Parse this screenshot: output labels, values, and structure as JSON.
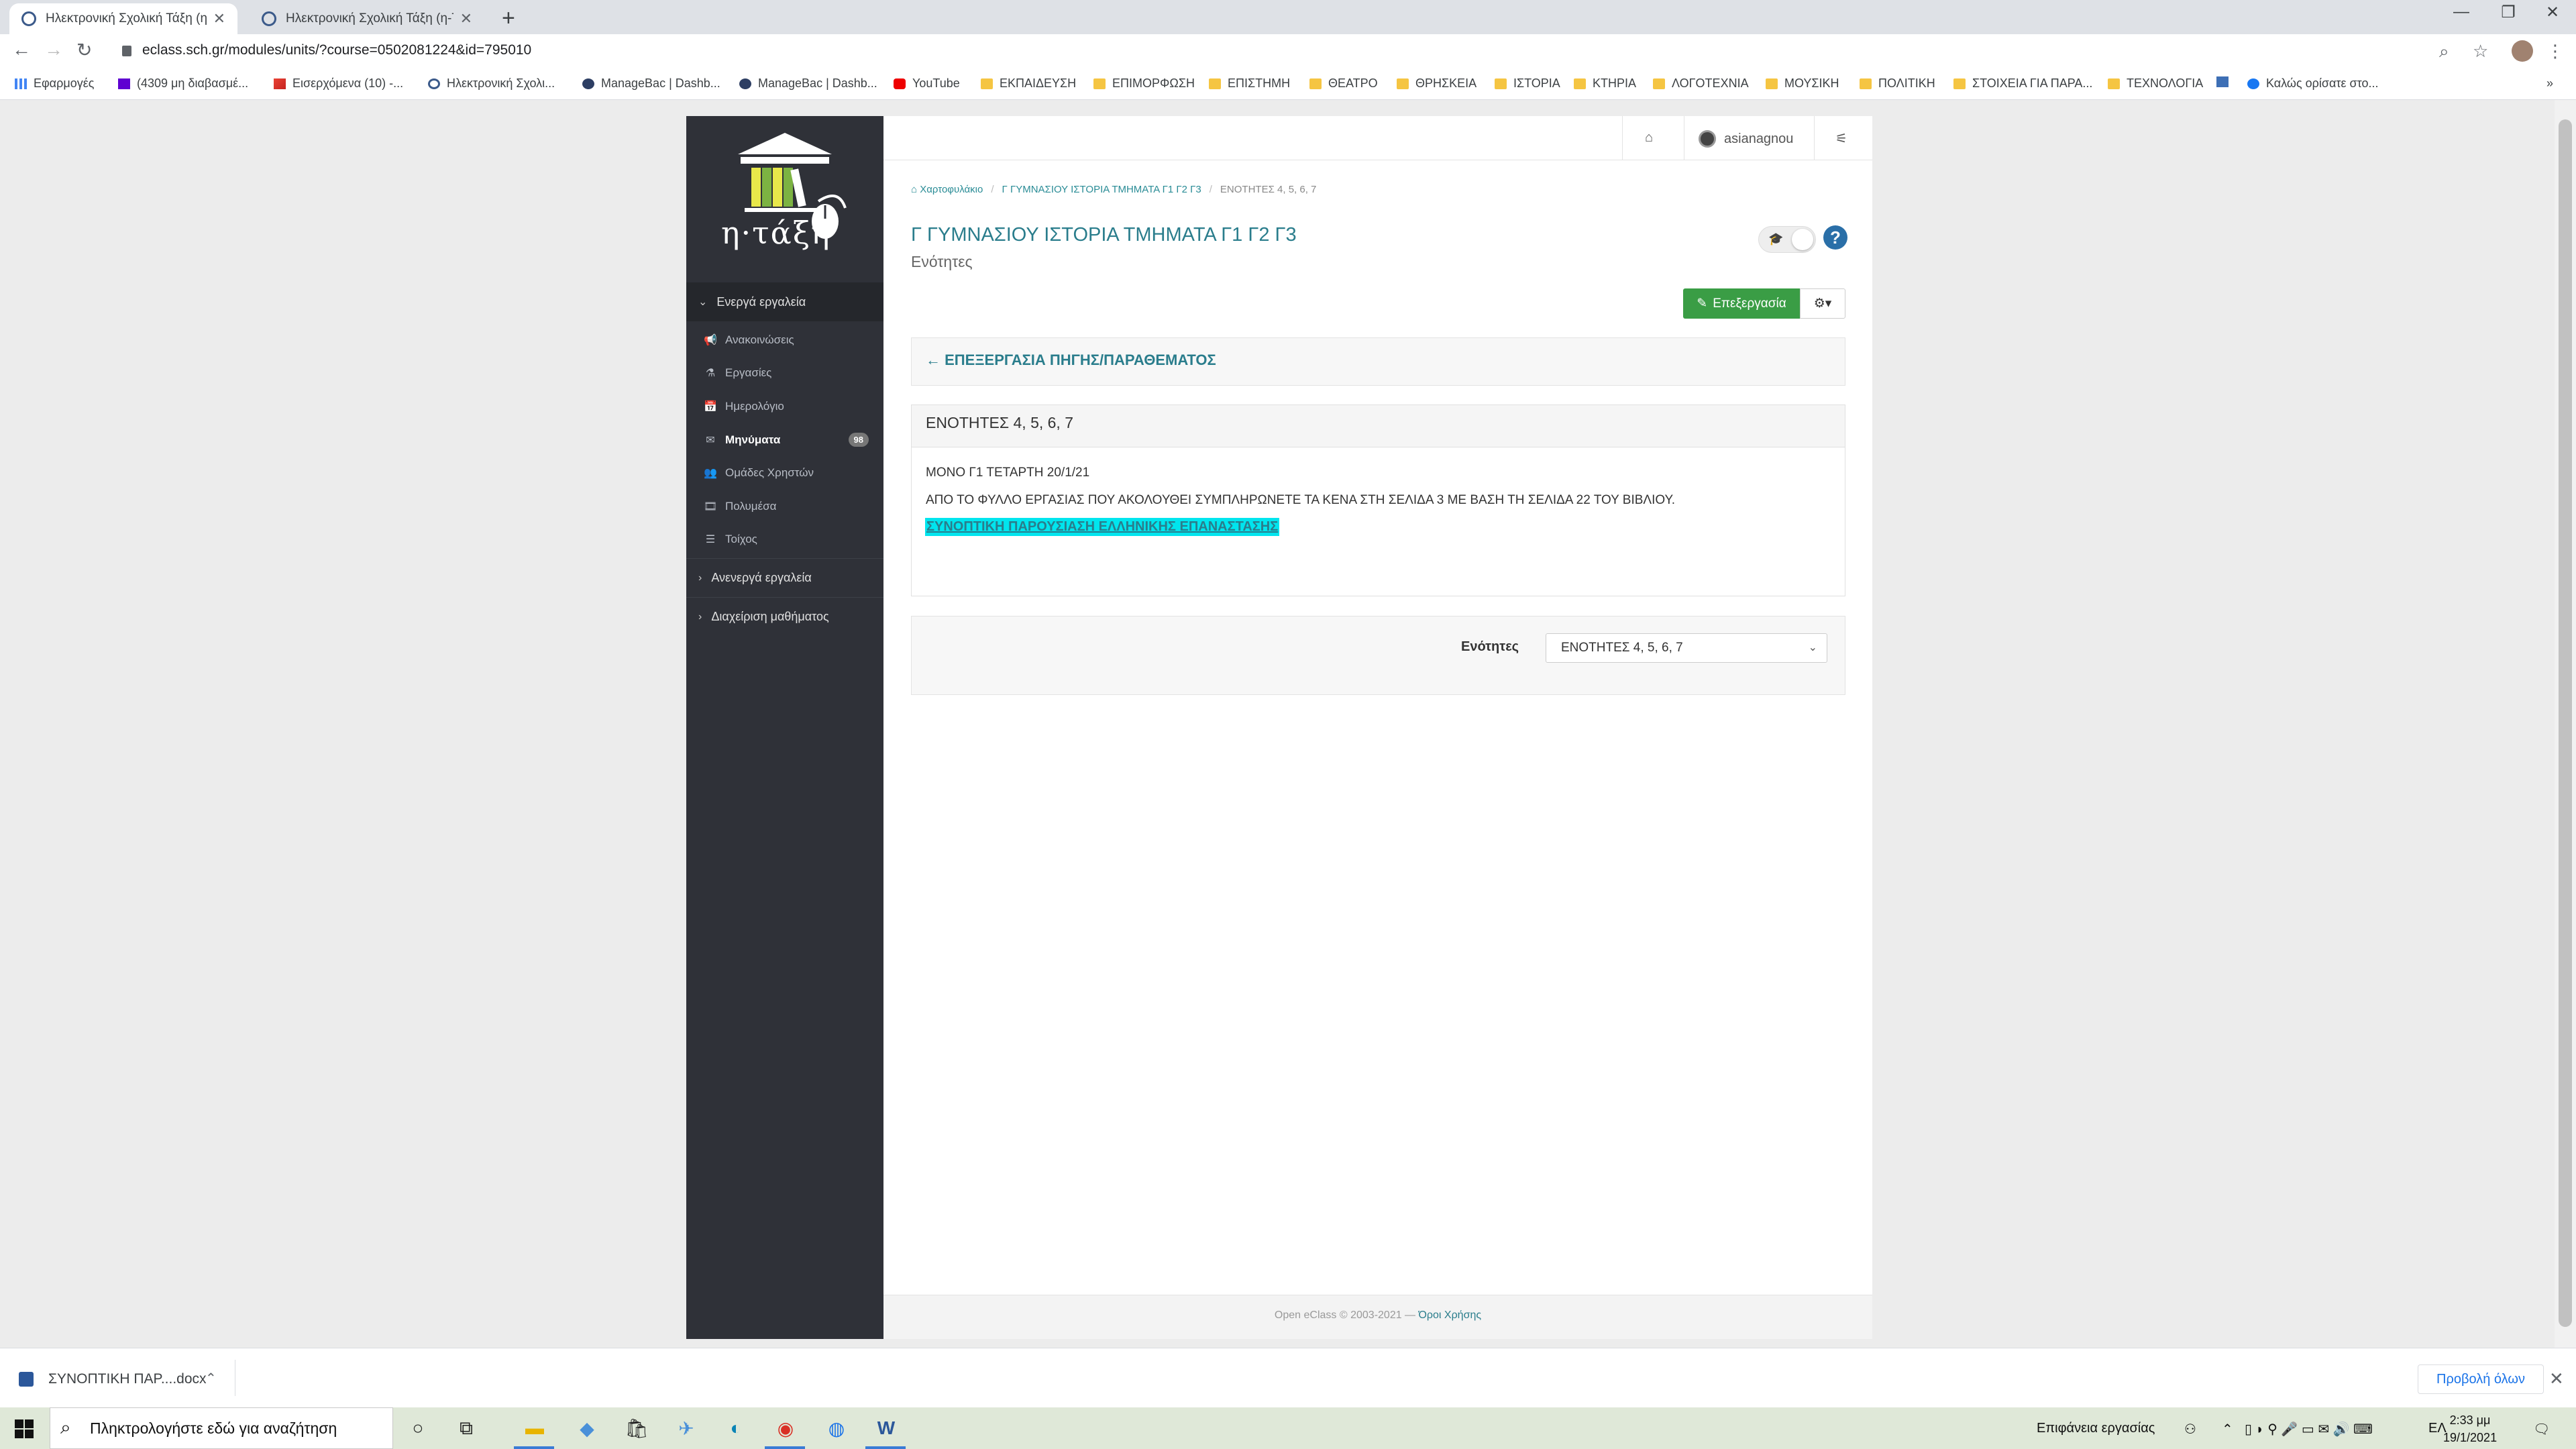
{
  "browser": {
    "tabs": [
      {
        "title": "Ηλεκτρονική Σχολική Τάξη (η-Τάξη)",
        "active": true
      },
      {
        "title": "Ηλεκτρονική Σχολική Τάξη (η-Τάξη)",
        "active": false
      }
    ],
    "url": "eclass.sch.gr/modules/units/?course=0502081224&id=795010",
    "bookmarks": [
      {
        "label": "Εφαρμογές",
        "icon": "apps-icon"
      },
      {
        "label": "(4309 μη διαβασμέ...",
        "icon": "yahoo-icon"
      },
      {
        "label": "Εισερχόμενα (10) -...",
        "icon": "gmail-icon"
      },
      {
        "label": "Ηλεκτρονική Σχολι...",
        "icon": "eclass-icon"
      },
      {
        "label": "ManageBac | Dashb...",
        "icon": "managebac-icon"
      },
      {
        "label": "ManageBac | Dashb...",
        "icon": "managebac-icon"
      },
      {
        "label": "YouTube",
        "icon": "youtube-icon"
      },
      {
        "label": "ΕΚΠΑΙΔΕΥΣΗ",
        "icon": "folder-icon"
      },
      {
        "label": "ΕΠΙΜΟΡΦΩΣΗ",
        "icon": "folder-icon"
      },
      {
        "label": "ΕΠΙΣΤΗΜΗ",
        "icon": "folder-icon"
      },
      {
        "label": "ΘΕΑΤΡΟ",
        "icon": "folder-icon"
      },
      {
        "label": "ΘΡΗΣΚΕΙΑ",
        "icon": "folder-icon"
      },
      {
        "label": "ΙΣΤΟΡΙΑ",
        "icon": "folder-icon"
      },
      {
        "label": "ΚΤΗΡΙΑ",
        "icon": "folder-icon"
      },
      {
        "label": "ΛΟΓΟΤΕΧΝΙΑ",
        "icon": "folder-icon"
      },
      {
        "label": "ΜΟΥΣΙΚΗ",
        "icon": "folder-icon"
      },
      {
        "label": "ΠΟΛΙΤΙΚΗ",
        "icon": "folder-icon"
      },
      {
        "label": "ΣΤΟΙΧΕΙΑ ΓΙΑ ΠΑΡΑ...",
        "icon": "folder-icon"
      },
      {
        "label": "ΤΕΧΝΟΛΟΓΙΑ",
        "icon": "folder-icon"
      },
      {
        "label": "Καλώς ορίσατε στο...",
        "icon": "facebook-icon"
      }
    ]
  },
  "app": {
    "logo_text": "η·τάξη",
    "user": "asianagnou",
    "sidebar": {
      "active_tools_label": "Ενεργά εργαλεία",
      "items": [
        {
          "label": "Ανακοινώσεις",
          "icon": "megaphone-icon",
          "glyph": "📢"
        },
        {
          "label": "Εργασίες",
          "icon": "flask-icon",
          "glyph": "⚗"
        },
        {
          "label": "Ημερολόγιο",
          "icon": "calendar-icon",
          "glyph": "📅"
        },
        {
          "label": "Μηνύματα",
          "icon": "envelope-icon",
          "glyph": "✉",
          "badge": "98"
        },
        {
          "label": "Ομάδες Χρηστών",
          "icon": "users-icon",
          "glyph": "👥"
        },
        {
          "label": "Πολυμέσα",
          "icon": "film-icon",
          "glyph": "🎞"
        },
        {
          "label": "Τοίχος",
          "icon": "list-icon",
          "glyph": "☰"
        }
      ],
      "inactive_tools_label": "Ανενεργά εργαλεία",
      "course_admin_label": "Διαχείριση μαθήματος"
    },
    "breadcrumb": {
      "home": "Χαρτοφυλάκιο",
      "course": "Γ ΓΥΜΝΑΣΙΟΥ ΙΣΤΟΡΙΑ ΤΜΗΜΑΤΑ Γ1 Γ2 Γ3",
      "current": "ΕΝΟΤΗΤΕΣ 4, 5, 6, 7"
    },
    "course_title": "Γ ΓΥΜΝΑΣΙΟΥ ΙΣΤΟΡΙΑ ΤΜΗΜΑΤΑ Γ1 Γ2 Γ3",
    "course_subtitle": "Ενότητες",
    "edit_label": "Επεξεργασία",
    "back_label": "ΕΠΕΞΕΡΓΑΣΙΑ ΠΗΓΗΣ/ΠΑΡΑΘΕΜΑΤΟΣ",
    "unit": {
      "title": "ΕΝΟΤΗΤΕΣ 4, 5, 6, 7",
      "line1": "ΜΟΝΟ Γ1 ΤΕΤΑΡΤΗ 20/1/21",
      "line2": "ΑΠΟ ΤΟ ΦΥΛΛΟ ΕΡΓΑΣΙΑΣ ΠΟΥ ΑΚΟΛΟΥΘΕΙ ΣΥΜΠΛΗΡΩΝΕΤΕ ΤΑ ΚΕΝΑ ΣΤΗ ΣΕΛΙΔΑ 3 ΜΕ ΒΑΣΗ ΤΗ ΣΕΛΙΔΑ 22 ΤΟΥ ΒΙΒΛΙΟΥ.",
      "link": "ΣΥΝΟΠΤΙΚΗ ΠΑΡΟΥΣΙΑΣΗ ΕΛΛΗΝΙΚΗΣ ΕΠΑΝΑΣΤΑΣΗΣ"
    },
    "units_nav": {
      "label": "Ενότητες",
      "selected": "ΕΝΟΤΗΤΕΣ 4, 5, 6, 7"
    },
    "footer": {
      "text": "Open eClass © 2003-2021 —",
      "terms": "Όροι Χρήσης"
    }
  },
  "downloads": {
    "file": "ΣΥΝΟΠΤΙΚΗ ΠΑΡ....docx",
    "show_all": "Προβολή όλων"
  },
  "taskbar": {
    "search_placeholder": "Πληκτρολογήστε εδώ για αναζήτηση",
    "desktop_label": "Επιφάνεια εργασίας",
    "language": "ΕΛ",
    "time": "2:33 μμ",
    "date": "19/1/2021"
  },
  "colors": {
    "accent": "#2a7d8c",
    "sidebar": "#2f3138",
    "edit_button": "#3a9d45",
    "highlight": "#00e5ee"
  }
}
